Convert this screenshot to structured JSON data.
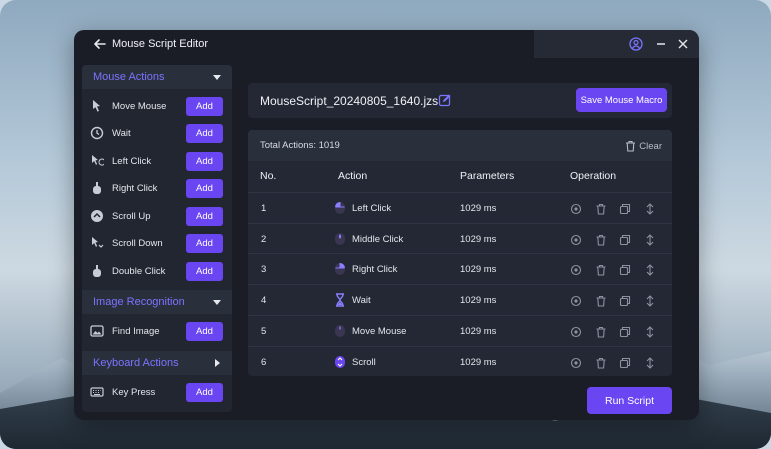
{
  "window": {
    "title": "Mouse Script Editor"
  },
  "sidebar": {
    "sections": [
      {
        "label": "Mouse Actions",
        "items": [
          {
            "label": "Move Mouse",
            "icon": "mouse-pointer-icon",
            "button": "Add"
          },
          {
            "label": "Wait",
            "icon": "timer-icon",
            "button": "Add"
          },
          {
            "label": "Left Click",
            "icon": "left-click-icon",
            "button": "Add"
          },
          {
            "label": "Right Click",
            "icon": "right-click-icon",
            "button": "Add"
          },
          {
            "label": "Scroll Up",
            "icon": "scroll-up-icon",
            "button": "Add"
          },
          {
            "label": "Scroll Down",
            "icon": "scroll-down-icon",
            "button": "Add"
          },
          {
            "label": "Double Click",
            "icon": "double-click-icon",
            "button": "Add"
          }
        ]
      },
      {
        "label": "Image Recognition",
        "items": [
          {
            "label": "Find Image",
            "icon": "image-icon",
            "button": "Add"
          }
        ]
      },
      {
        "label": "Keyboard Actions",
        "items": [
          {
            "label": "Key Press",
            "icon": "keyboard-icon",
            "button": "Add"
          }
        ]
      }
    ]
  },
  "editor": {
    "filename": "MouseScript_20240805_1640.jzs",
    "save_label": "Save Mouse Macro",
    "total_label": "Total Actions:",
    "total_count": "1019",
    "clear_label": "Clear",
    "run_label": "Run Script"
  },
  "table": {
    "headers": [
      "No.",
      "Action",
      "Parameters",
      "Operation"
    ],
    "rows": [
      {
        "no": "1",
        "action": "Left Click",
        "icon": "left-click-icon",
        "param": "1029 ms"
      },
      {
        "no": "2",
        "action": "Middle Click",
        "icon": "middle-click-icon",
        "param": "1029 ms"
      },
      {
        "no": "3",
        "action": "Right Click",
        "icon": "right-click-icon",
        "param": "1029 ms"
      },
      {
        "no": "4",
        "action": "Wait",
        "icon": "hourglass-icon",
        "param": "1029 ms"
      },
      {
        "no": "5",
        "action": "Move Mouse",
        "icon": "mouse-icon",
        "param": "1029 ms"
      },
      {
        "no": "6",
        "action": "Scroll",
        "icon": "scroll-icon",
        "param": "1029 ms"
      }
    ]
  },
  "colors": {
    "accent": "#6a46f2",
    "section_label": "#7b74ff",
    "window_bg": "#1a1d26"
  }
}
